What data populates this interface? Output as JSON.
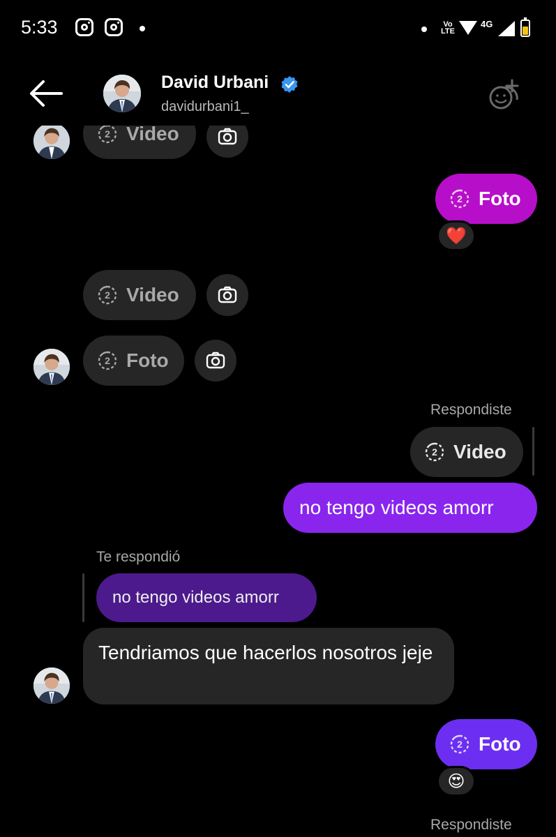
{
  "status_bar": {
    "time": "5:33",
    "volte": "Vo\nLTE",
    "network": "4G",
    "icons": [
      "instagram-icon",
      "instagram-icon",
      "dot",
      "dot",
      "volte-icon",
      "wifi-icon",
      "signal-icon",
      "battery-icon"
    ]
  },
  "header": {
    "name": "David Urbani",
    "username": "davidurbani1_",
    "verified": true,
    "accent": "#3897f0"
  },
  "messages": {
    "m1": {
      "label": "Video"
    },
    "m2": {
      "label": "Foto",
      "reaction": "❤️"
    },
    "m3": {
      "label": "Video"
    },
    "m4": {
      "label": "Foto"
    },
    "m5": {
      "meta": "Respondiste",
      "reply_to": "Video",
      "text": "no tengo videos amorr"
    },
    "m6": {
      "meta": "Te respondió",
      "reply_to": "no tengo videos amorr",
      "text": "Tendriamos que hacerlos nosotros jeje"
    },
    "m7": {
      "label": "Foto",
      "reaction": "😍"
    },
    "m8": {
      "meta": "Respondiste"
    }
  },
  "colors": {
    "background": "#000000",
    "received_bubble": "#262626",
    "sent_magenta": "#b70fc9",
    "sent_violet": "#8a25ee",
    "sent_indigo": "#6c2ff2",
    "reply_preview": "#4c1a8c"
  }
}
